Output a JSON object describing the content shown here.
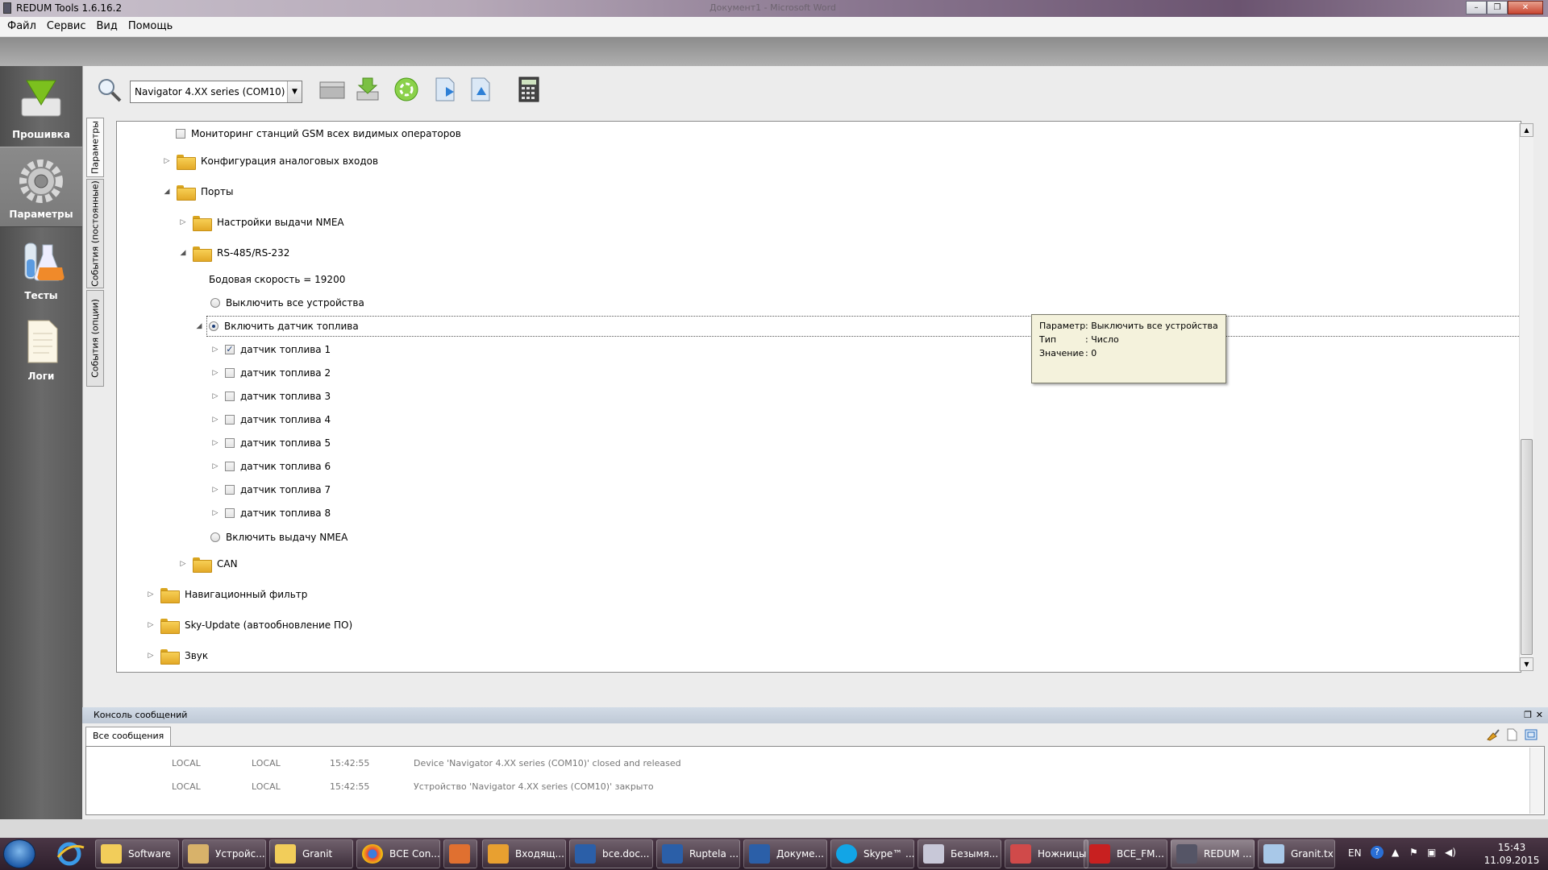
{
  "window": {
    "title": "REDUM Tools 1.6.16.2",
    "background_title": "Документ1 - Microsoft Word"
  },
  "menu": [
    "Файл",
    "Сервис",
    "Вид",
    "Помощь"
  ],
  "sidebar": [
    {
      "label": "Прошивка",
      "icon": "download-arrow-icon"
    },
    {
      "label": "Параметры",
      "icon": "gear-icon",
      "active": true
    },
    {
      "label": "Тесты",
      "icon": "flasks-icon"
    },
    {
      "label": "Логи",
      "icon": "document-icon"
    }
  ],
  "toolbar": {
    "device": "Navigator 4.XX series (COM10)"
  },
  "vertical_tabs": [
    "Параметры",
    "События (постоянные)",
    "События (опции)"
  ],
  "tree": {
    "gsm_monitor": "Мониторинг станций GSM всех видимых операторов",
    "analog_inputs": "Конфигурация аналоговых входов",
    "ports": "Порты",
    "nmea_settings": "Настройки выдачи NMEA",
    "rs485": "RS-485/RS-232",
    "baud": "Бодовая скорость = 19200",
    "disable_all": "Выключить все устройства",
    "enable_fuel": "Включить датчик топлива",
    "fuel_sensors": [
      {
        "label": "датчик топлива 1",
        "checked": true
      },
      {
        "label": "датчик топлива 2",
        "checked": false
      },
      {
        "label": "датчик топлива 3",
        "checked": false
      },
      {
        "label": "датчик топлива 4",
        "checked": false
      },
      {
        "label": "датчик топлива 5",
        "checked": false
      },
      {
        "label": "датчик топлива 6",
        "checked": false
      },
      {
        "label": "датчик топлива 7",
        "checked": false
      },
      {
        "label": "датчик топлива 8",
        "checked": false
      }
    ],
    "enable_nmea": "Включить выдачу NMEA",
    "can": "CAN",
    "nav_filter": "Навигационный фильтр",
    "sky_update": "Sky-Update (автообновление ПО)",
    "sound": "Звук"
  },
  "tooltip": {
    "k1": "Параметр",
    "v1": ": Выключить все устройства",
    "k2": "Тип",
    "v2": ": Число",
    "k3": "Значение",
    "v3": ": 0"
  },
  "console": {
    "title": "Консоль сообщений",
    "tab": "Все сообщения",
    "rows": [
      {
        "src": "LOCAL",
        "dst": "LOCAL",
        "time": "15:42:55",
        "msg": "Device 'Navigator 4.XX series (COM10)' closed and released"
      },
      {
        "src": "LOCAL",
        "dst": "LOCAL",
        "time": "15:42:55",
        "msg": "Устройство 'Navigator 4.XX series (COM10)' закрыто"
      }
    ]
  },
  "taskbar": {
    "tasks": [
      "Software",
      "Устройс...",
      "Granit",
      "ВСЕ Con...",
      "",
      "Входящ...",
      "bce.doc...",
      "Ruptela ...",
      "Докуме...",
      "Skype™ ...",
      "Безымя...",
      "Ножницы",
      "ВСЕ_FM...",
      "REDUM ...",
      "Granit.tx..."
    ],
    "lang": "EN",
    "time": "15:43",
    "date": "11.09.2015"
  }
}
